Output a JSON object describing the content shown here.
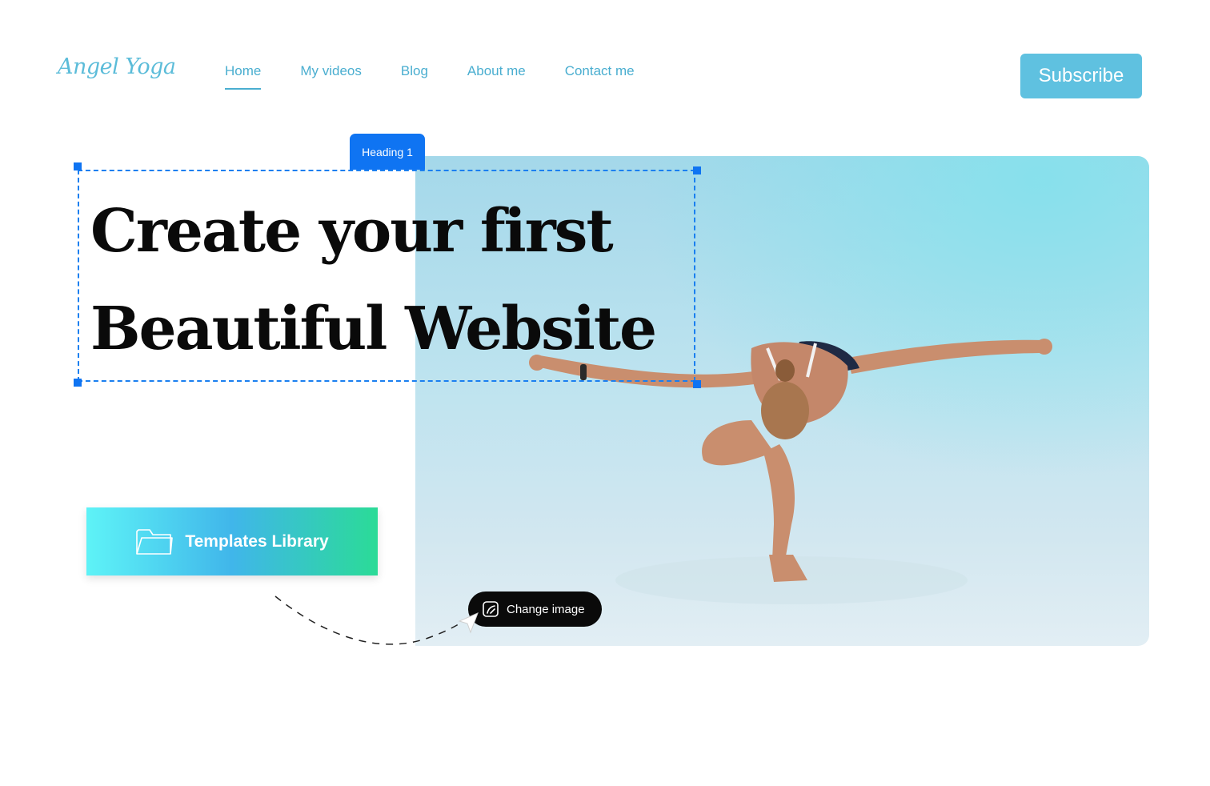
{
  "header": {
    "logo": "Angel Yoga",
    "nav": [
      {
        "label": "Home",
        "active": true
      },
      {
        "label": "My videos",
        "active": false
      },
      {
        "label": "Blog",
        "active": false
      },
      {
        "label": "About me",
        "active": false
      },
      {
        "label": "Contact me",
        "active": false
      }
    ],
    "subscribe_label": "Subscribe"
  },
  "editor": {
    "selection_tag": "Heading 1"
  },
  "hero": {
    "heading_line1": "Create your first",
    "heading_line2": "Beautiful Website"
  },
  "templates_button": {
    "label": "Templates Library",
    "icon": "folder-icon"
  },
  "change_image": {
    "label": "Change image",
    "icon": "image-edit-icon"
  },
  "colors": {
    "accent": "#5fc1e0",
    "nav_text": "#4aaed0",
    "selection": "#0f74f2",
    "gradient_start": "#5ef3f7",
    "gradient_end": "#2bdb97"
  }
}
